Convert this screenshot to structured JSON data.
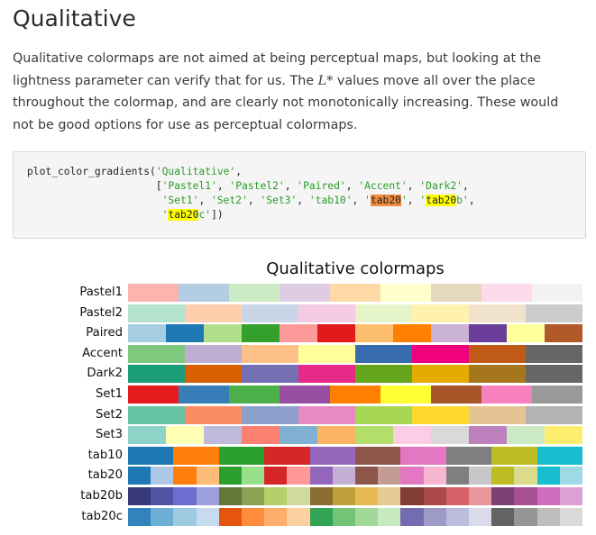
{
  "heading": "Qualitative",
  "paragraph": {
    "before": "Qualitative colormaps are not aimed at being perceptual maps, but looking at the lightness parameter can verify that for us. The ",
    "math": "L*",
    "after": " values move all over the place throughout the colormap, and are clearly not monotonically increasing. These would not be good options for use as perceptual colormaps."
  },
  "code": {
    "func": "plot_color_gradients(",
    "arg1": "'Qualitative'",
    "indent": "                     ",
    "l2": [
      "'Pastel1'",
      "'Pastel2'",
      "'Paired'",
      "'Accent'",
      "'Dark2'"
    ],
    "l3": [
      "'Set1'",
      "'Set2'",
      "'Set3'",
      "'tab10'"
    ],
    "tab20_q": "'",
    "tab20_hl": "tab20",
    "tab20b_hl": "tab20",
    "tab20b_rest": "b'",
    "tab20c_hl": "tab20",
    "tab20c_rest": "c'",
    "close": "])"
  },
  "figure": {
    "title": "Qualitative colormaps",
    "colormaps": [
      {
        "name": "Pastel1",
        "colors": [
          "#fbb4ae",
          "#b3cde3",
          "#ccebc5",
          "#decbe4",
          "#fed9a6",
          "#ffffcc",
          "#e5d8bd",
          "#fddaec",
          "#f2f2f2"
        ]
      },
      {
        "name": "Pastel2",
        "colors": [
          "#b3e2cd",
          "#fdcdac",
          "#cbd5e8",
          "#f4cae4",
          "#e6f5c9",
          "#fff2ae",
          "#f1e2cc",
          "#cccccc"
        ]
      },
      {
        "name": "Paired",
        "colors": [
          "#a6cee3",
          "#1f78b4",
          "#b2df8a",
          "#33a02c",
          "#fb9a99",
          "#e31a1c",
          "#fdbf6f",
          "#ff7f00",
          "#cab2d6",
          "#6a3d9a",
          "#ffff99",
          "#b15928"
        ]
      },
      {
        "name": "Accent",
        "colors": [
          "#7fc97f",
          "#beaed4",
          "#fdc086",
          "#ffff99",
          "#386cb0",
          "#f0027f",
          "#bf5b17",
          "#666666"
        ]
      },
      {
        "name": "Dark2",
        "colors": [
          "#1b9e77",
          "#d95f02",
          "#7570b3",
          "#e7298a",
          "#66a61e",
          "#e6ab02",
          "#a6761d",
          "#666666"
        ]
      },
      {
        "name": "Set1",
        "colors": [
          "#e41a1c",
          "#377eb8",
          "#4daf4a",
          "#984ea3",
          "#ff7f00",
          "#ffff33",
          "#a65628",
          "#f781bf",
          "#999999"
        ]
      },
      {
        "name": "Set2",
        "colors": [
          "#66c2a5",
          "#fc8d62",
          "#8da0cb",
          "#e78ac3",
          "#a6d854",
          "#ffd92f",
          "#e5c494",
          "#b3b3b3"
        ]
      },
      {
        "name": "Set3",
        "colors": [
          "#8dd3c7",
          "#ffffb3",
          "#bebada",
          "#fb8072",
          "#80b1d3",
          "#fdb462",
          "#b3de69",
          "#fccde5",
          "#d9d9d9",
          "#bc80bd",
          "#ccebc5",
          "#ffed6f"
        ]
      },
      {
        "name": "tab10",
        "colors": [
          "#1f77b4",
          "#ff7f0e",
          "#2ca02c",
          "#d62728",
          "#9467bd",
          "#8c564b",
          "#e377c2",
          "#7f7f7f",
          "#bcbd22",
          "#17becf"
        ]
      },
      {
        "name": "tab20",
        "colors": [
          "#1f77b4",
          "#aec7e8",
          "#ff7f0e",
          "#ffbb78",
          "#2ca02c",
          "#98df8a",
          "#d62728",
          "#ff9896",
          "#9467bd",
          "#c5b0d5",
          "#8c564b",
          "#c49c94",
          "#e377c2",
          "#f7b6d2",
          "#7f7f7f",
          "#c7c7c7",
          "#bcbd22",
          "#dbdb8d",
          "#17becf",
          "#9edae5"
        ]
      },
      {
        "name": "tab20b",
        "colors": [
          "#393b79",
          "#5254a3",
          "#6b6ecf",
          "#9c9ede",
          "#637939",
          "#8ca252",
          "#b5cf6b",
          "#cedb9c",
          "#8c6d31",
          "#bd9e39",
          "#e7ba52",
          "#e7cb94",
          "#843c39",
          "#ad494a",
          "#d6616b",
          "#e7969c",
          "#7b4173",
          "#a55194",
          "#ce6dbd",
          "#de9ed6"
        ]
      },
      {
        "name": "tab20c",
        "colors": [
          "#3182bd",
          "#6baed6",
          "#9ecae1",
          "#c6dbef",
          "#e6550d",
          "#fd8d3c",
          "#fdae6b",
          "#fdd0a2",
          "#31a354",
          "#74c476",
          "#a1d99b",
          "#c7e9c0",
          "#756bb1",
          "#9e9ac8",
          "#bcbddc",
          "#dadaeb",
          "#636363",
          "#969696",
          "#bdbdbd",
          "#d9d9d9"
        ]
      }
    ]
  }
}
